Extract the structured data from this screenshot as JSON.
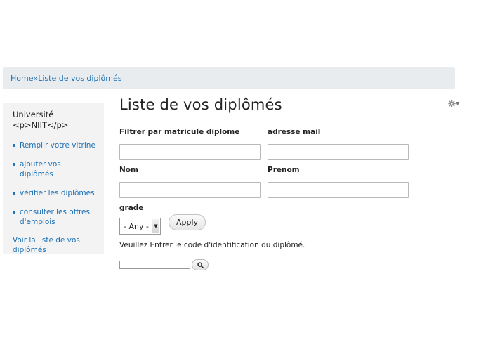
{
  "breadcrumb": {
    "home": "Home",
    "separator": "»",
    "current": "Liste de vos diplômés"
  },
  "sidebar": {
    "title": "Université <p>NIIT</p>",
    "items": [
      {
        "label": "Remplir votre vitrine"
      },
      {
        "label": "ajouter vos diplômés"
      },
      {
        "label": "vérifier les diplômes"
      },
      {
        "label": "consulter les offres d'emplois"
      }
    ],
    "bottom_link": "Voir la liste de vos diplômés"
  },
  "page": {
    "title": "Liste de vos diplômés",
    "settings_icon": "gear-icon"
  },
  "filters": {
    "matricule_label": "Filtrer par matricule diplome",
    "email_label": "adresse mail",
    "nom_label": "Nom",
    "prenom_label": "Prenom",
    "grade_label": "grade",
    "grade_value": "- Any -",
    "apply_label": "Apply"
  },
  "code_search": {
    "help_text": "Veuillez Entrer le code d'identification du diplômé.",
    "search_icon": "search-icon"
  },
  "colors": {
    "link": "#1a6fb5",
    "breadcrumb_bg": "#e9ecef",
    "sidebar_bg": "#f3f3f3"
  }
}
